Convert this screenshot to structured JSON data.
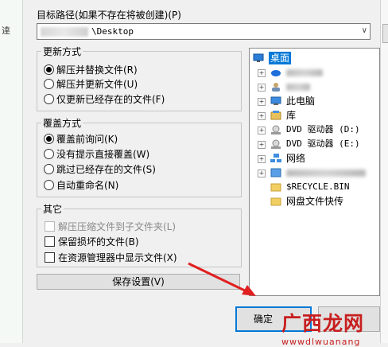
{
  "left_panel": {
    "text": "逹"
  },
  "target_path": {
    "label": "目标路径(如果不存在将被创建)(P)",
    "value": "\\Desktop"
  },
  "update_mode": {
    "title": "更新方式",
    "options": [
      {
        "label": "解压并替换文件(R)",
        "checked": true
      },
      {
        "label": "解压并更新文件(U)",
        "checked": false
      },
      {
        "label": "仅更新已经存在的文件(F)",
        "checked": false
      }
    ]
  },
  "overwrite_mode": {
    "title": "覆盖方式",
    "options": [
      {
        "label": "覆盖前询问(K)",
        "checked": true
      },
      {
        "label": "没有提示直接覆盖(W)",
        "checked": false
      },
      {
        "label": "跳过已经存在的文件(S)",
        "checked": false
      },
      {
        "label": "自动重命名(N)",
        "checked": false
      }
    ]
  },
  "other": {
    "title": "其它",
    "options": [
      {
        "label": "解压压缩文件到子文件夹(L)",
        "checked": false,
        "disabled": true
      },
      {
        "label": "保留损坏的文件(B)",
        "checked": false,
        "disabled": false
      },
      {
        "label": "在资源管理器中显示文件(X)",
        "checked": false,
        "disabled": false
      }
    ]
  },
  "save_settings": "保存设置(V)",
  "tree": {
    "root": "桌面",
    "items": [
      {
        "label": "此电脑",
        "icon": "computer-icon"
      },
      {
        "label": "库",
        "icon": "library-icon"
      },
      {
        "label": "DVD 驱动器 (D:)",
        "icon": "dvd-drive-icon"
      },
      {
        "label": "DVD 驱动器 (E:)",
        "icon": "dvd-drive-icon"
      },
      {
        "label": "网络",
        "icon": "network-icon"
      },
      {
        "label": "$RECYCLE.BIN",
        "icon": "folder-icon"
      },
      {
        "label": "网盘文件快传",
        "icon": "folder-icon"
      }
    ]
  },
  "buttons": {
    "ok": "确定"
  },
  "watermark": {
    "main": "广西龙网",
    "sub": "wwwdlwuanang"
  },
  "colors": {
    "selection": "#0078d7",
    "arrow": "#e02020",
    "watermark": "#c81e1e"
  }
}
